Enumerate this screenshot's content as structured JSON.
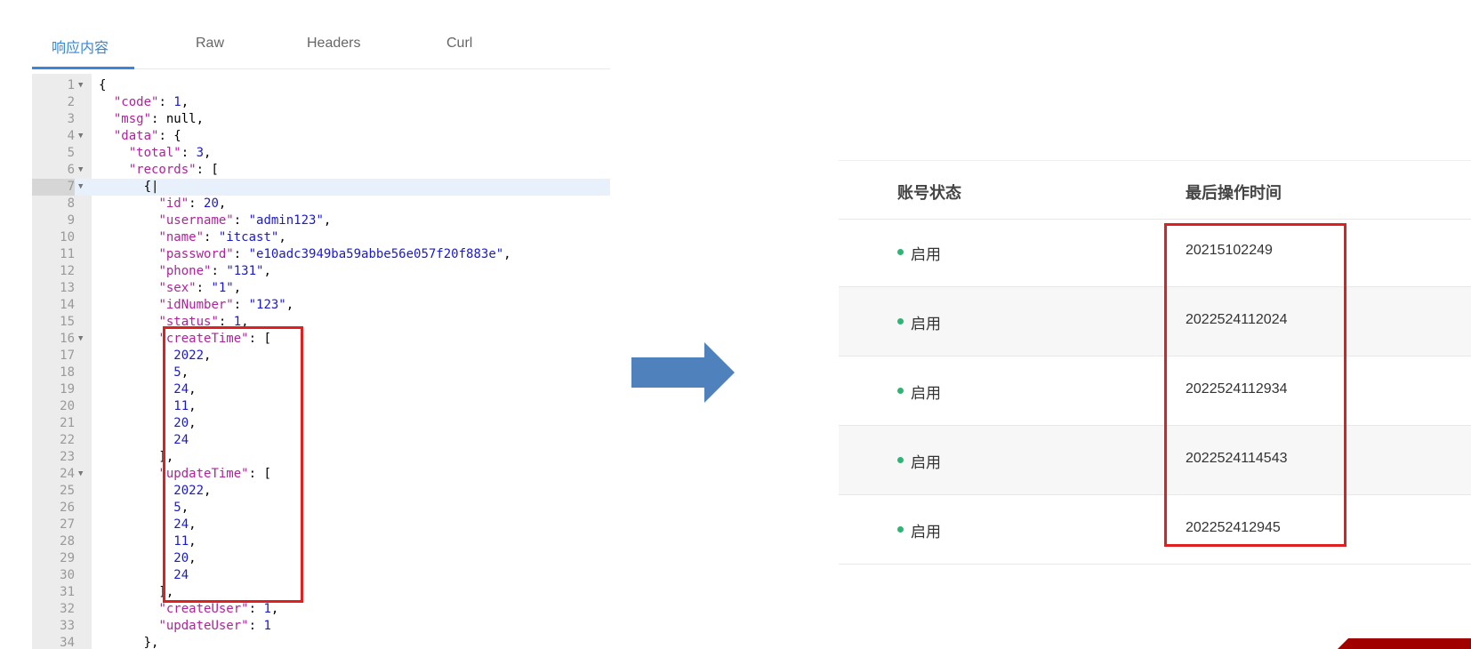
{
  "tabs": [
    {
      "label": "响应内容",
      "active": true
    },
    {
      "label": "Raw",
      "active": false
    },
    {
      "label": "Headers",
      "active": false
    },
    {
      "label": "Curl",
      "active": false
    }
  ],
  "code_lines": [
    {
      "n": "1",
      "fold": true,
      "text": "{"
    },
    {
      "n": "2",
      "fold": false,
      "text": "  \"code\": 1,"
    },
    {
      "n": "3",
      "fold": false,
      "text": "  \"msg\": null,"
    },
    {
      "n": "4",
      "fold": true,
      "text": "  \"data\": {"
    },
    {
      "n": "5",
      "fold": false,
      "text": "    \"total\": 3,"
    },
    {
      "n": "6",
      "fold": true,
      "text": "    \"records\": ["
    },
    {
      "n": "7",
      "fold": true,
      "text": "      {|",
      "active": true
    },
    {
      "n": "8",
      "fold": false,
      "text": "        \"id\": 20,"
    },
    {
      "n": "9",
      "fold": false,
      "text": "        \"username\": \"admin123\","
    },
    {
      "n": "10",
      "fold": false,
      "text": "        \"name\": \"itcast\","
    },
    {
      "n": "11",
      "fold": false,
      "text": "        \"password\": \"e10adc3949ba59abbe56e057f20f883e\","
    },
    {
      "n": "12",
      "fold": false,
      "text": "        \"phone\": \"131\","
    },
    {
      "n": "13",
      "fold": false,
      "text": "        \"sex\": \"1\","
    },
    {
      "n": "14",
      "fold": false,
      "text": "        \"idNumber\": \"123\","
    },
    {
      "n": "15",
      "fold": false,
      "text": "        \"status\": 1,"
    },
    {
      "n": "16",
      "fold": true,
      "text": "        \"createTime\": ["
    },
    {
      "n": "17",
      "fold": false,
      "text": "          2022,"
    },
    {
      "n": "18",
      "fold": false,
      "text": "          5,"
    },
    {
      "n": "19",
      "fold": false,
      "text": "          24,"
    },
    {
      "n": "20",
      "fold": false,
      "text": "          11,"
    },
    {
      "n": "21",
      "fold": false,
      "text": "          20,"
    },
    {
      "n": "22",
      "fold": false,
      "text": "          24"
    },
    {
      "n": "23",
      "fold": false,
      "text": "        ],"
    },
    {
      "n": "24",
      "fold": true,
      "text": "        \"updateTime\": ["
    },
    {
      "n": "25",
      "fold": false,
      "text": "          2022,"
    },
    {
      "n": "26",
      "fold": false,
      "text": "          5,"
    },
    {
      "n": "27",
      "fold": false,
      "text": "          24,"
    },
    {
      "n": "28",
      "fold": false,
      "text": "          11,"
    },
    {
      "n": "29",
      "fold": false,
      "text": "          20,"
    },
    {
      "n": "30",
      "fold": false,
      "text": "          24"
    },
    {
      "n": "31",
      "fold": false,
      "text": "        ],"
    },
    {
      "n": "32",
      "fold": false,
      "text": "        \"createUser\": 1,"
    },
    {
      "n": "33",
      "fold": false,
      "text": "        \"updateUser\": 1"
    },
    {
      "n": "34",
      "fold": false,
      "text": "      },"
    }
  ],
  "table": {
    "headers": [
      "账号状态",
      "最后操作时间"
    ],
    "rows": [
      {
        "status": "启用",
        "time": "20215102249"
      },
      {
        "status": "启用",
        "time": "2022524112024"
      },
      {
        "status": "启用",
        "time": "2022524112934"
      },
      {
        "status": "启用",
        "time": "2022524114543"
      },
      {
        "status": "启用",
        "time": "202252412945"
      }
    ]
  },
  "colors": {
    "accent": "#3a87d6",
    "highlight_box": "#e02020",
    "arrow": "#4f81bd",
    "status_dot": "#2bb673"
  }
}
